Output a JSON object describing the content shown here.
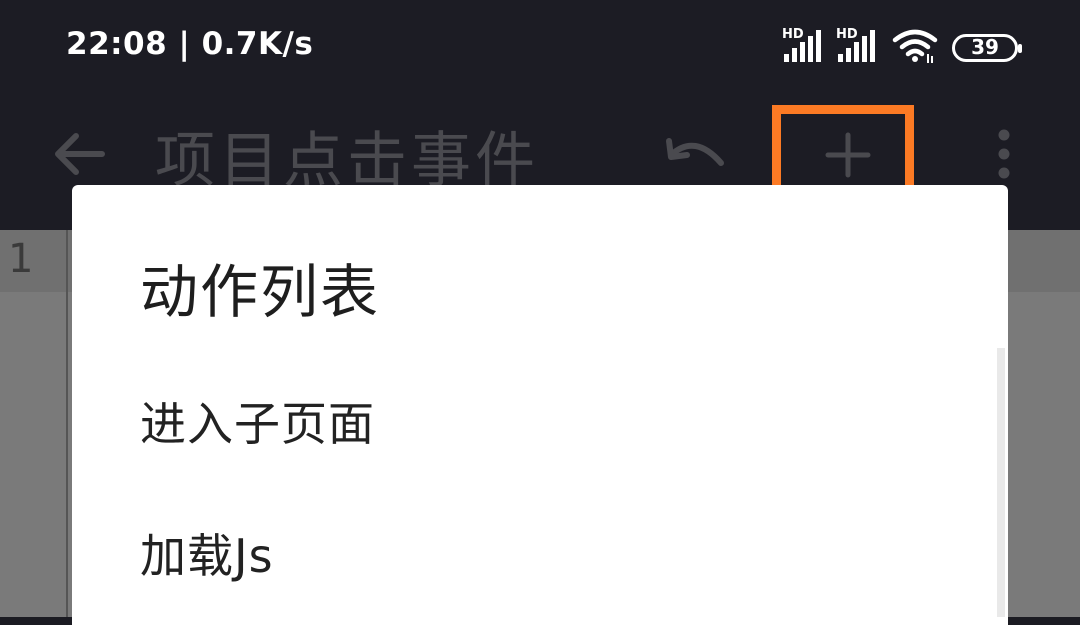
{
  "status_bar": {
    "time_speed": "22:08 | 0.7K/s",
    "signal1_label": "HD",
    "signal2_label": "HD",
    "battery": "39",
    "icons": [
      "signal-icon",
      "signal-icon",
      "wifi-icon",
      "battery-icon"
    ]
  },
  "toolbar": {
    "title": "项目点击事件",
    "icons": [
      "back-arrow-icon",
      "undo-icon",
      "plus-icon",
      "more-vert-icon"
    ],
    "highlight_color": "#fc7a24"
  },
  "editor": {
    "line_number": "1"
  },
  "dialog": {
    "title": "动作列表",
    "items": [
      {
        "label": "进入子页面"
      },
      {
        "label": "加载Js"
      }
    ]
  }
}
